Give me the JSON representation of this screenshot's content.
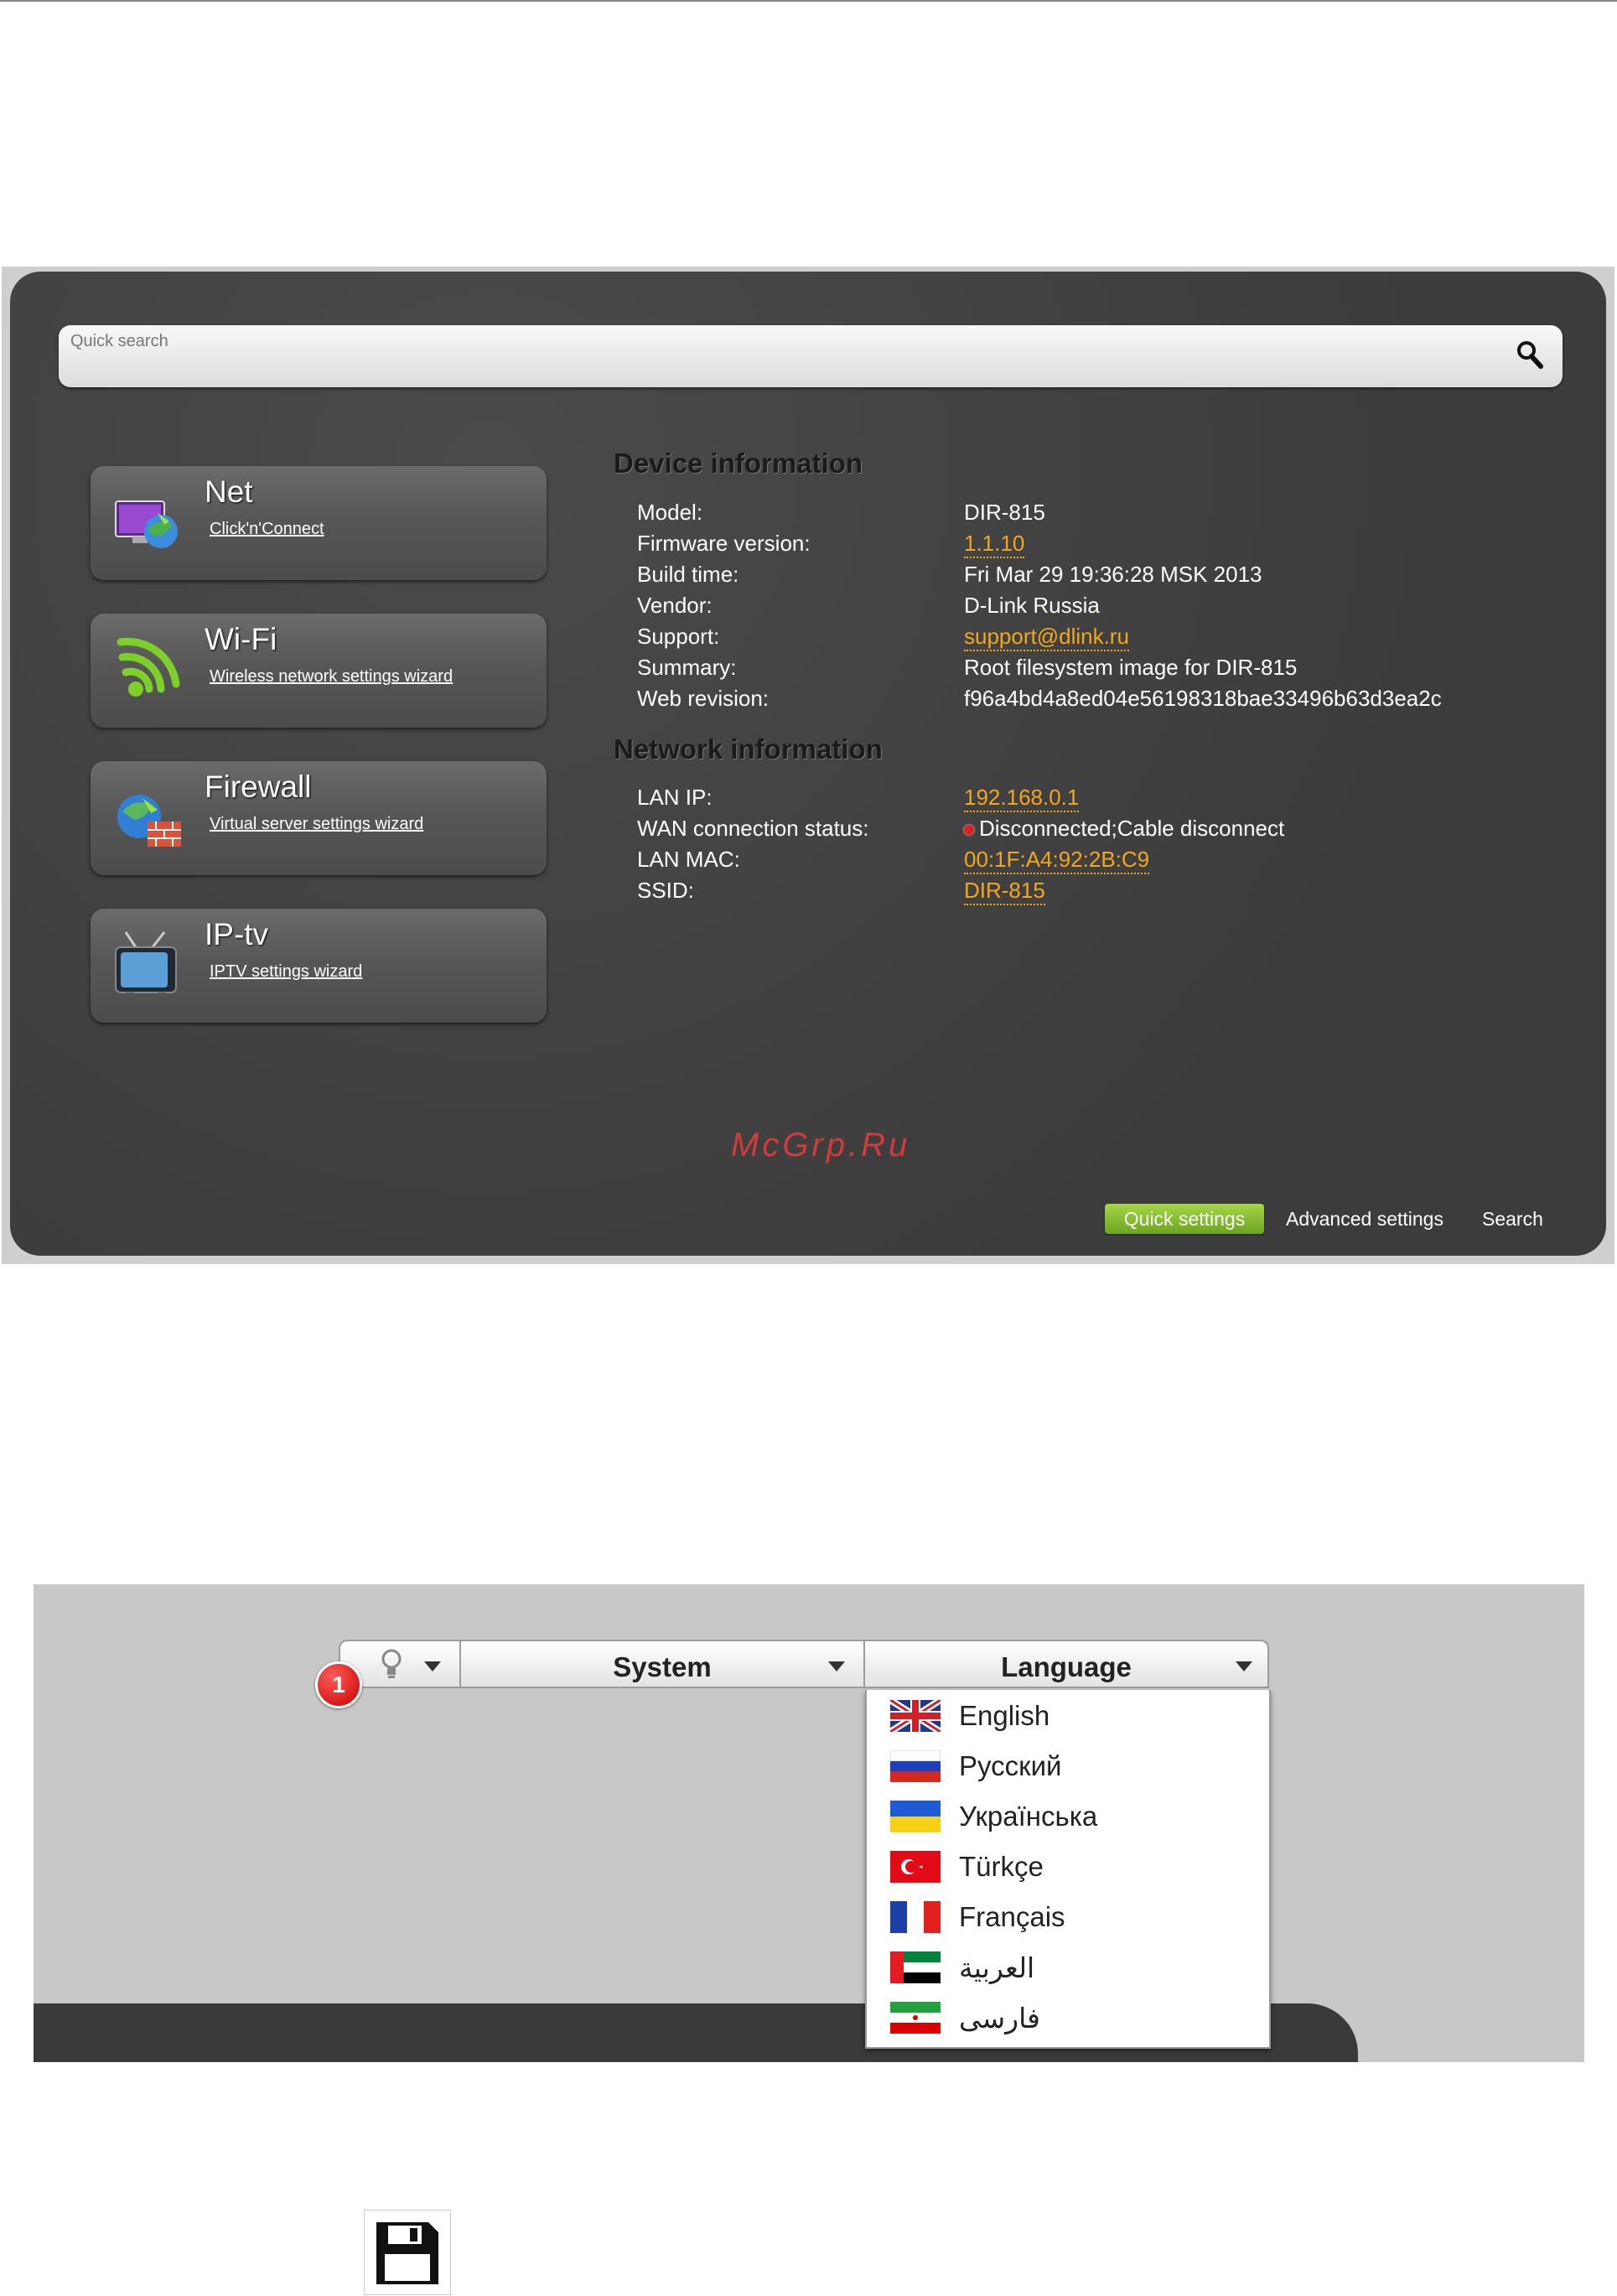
{
  "screenshot1": {
    "search": {
      "placeholder": "Quick search",
      "icon": "search-icon"
    },
    "tiles": [
      {
        "title": "Net",
        "link": "Click'n'Connect",
        "icon": "network-globe-icon"
      },
      {
        "title": "Wi-Fi",
        "link": "Wireless network settings wizard",
        "icon": "wifi-icon"
      },
      {
        "title": "Firewall",
        "link": "Virtual server settings wizard",
        "icon": "firewall-icon"
      },
      {
        "title": "IP-tv",
        "link": "IPTV settings wizard",
        "icon": "tv-icon"
      }
    ],
    "device_info": {
      "title": "Device information",
      "rows": [
        {
          "label": "Model:",
          "value": "DIR-815",
          "link": false
        },
        {
          "label": "Firmware version:",
          "value": "1.1.10",
          "link": true
        },
        {
          "label": "Build time:",
          "value": "Fri Mar 29 19:36:28 MSK 2013",
          "link": false
        },
        {
          "label": "Vendor:",
          "value": "D-Link Russia",
          "link": false
        },
        {
          "label": "Support:",
          "value": "support@dlink.ru",
          "link": true
        },
        {
          "label": "Summary:",
          "value": "Root filesystem image for DIR-815",
          "link": false
        },
        {
          "label": "Web revision:",
          "value": "f96a4bd4a8ed04e56198318bae33496b63d3ea2c",
          "link": false
        }
      ]
    },
    "network_info": {
      "title": "Network information",
      "rows": [
        {
          "label": "LAN IP:",
          "value": "192.168.0.1",
          "link": true
        },
        {
          "label": "WAN connection status:",
          "value": "Disconnected;Cable disconnect",
          "link": false
        },
        {
          "label": "LAN MAC:",
          "value": "00:1F:A4:92:2B:C9",
          "link": true
        },
        {
          "label": "SSID:",
          "value": "DIR-815",
          "link": true
        }
      ]
    },
    "watermark": "McGrp.Ru",
    "footer": {
      "quick_settings": "Quick settings",
      "advanced_settings": "Advanced settings",
      "search": "Search"
    },
    "colors": {
      "panel": "#424242",
      "link": "#f2a81d",
      "accent_green": "#8cc63f",
      "status_red": "#e02020"
    }
  },
  "screenshot2": {
    "badge": "1",
    "menus": {
      "bulb_icon": "lightbulb-icon",
      "system": "System",
      "language": "Language"
    },
    "languages": [
      {
        "label": "English",
        "flag": "uk-flag-icon"
      },
      {
        "label": "Русский",
        "flag": "russia-flag-icon"
      },
      {
        "label": "Українська",
        "flag": "ukraine-flag-icon"
      },
      {
        "label": "Türkçe",
        "flag": "turkey-flag-icon"
      },
      {
        "label": "Français",
        "flag": "france-flag-icon"
      },
      {
        "label": "العربية",
        "flag": "uae-flag-icon"
      },
      {
        "label": "فارسی",
        "flag": "iran-flag-icon"
      }
    ]
  },
  "floppy": {
    "icon": "save-floppy-icon"
  }
}
